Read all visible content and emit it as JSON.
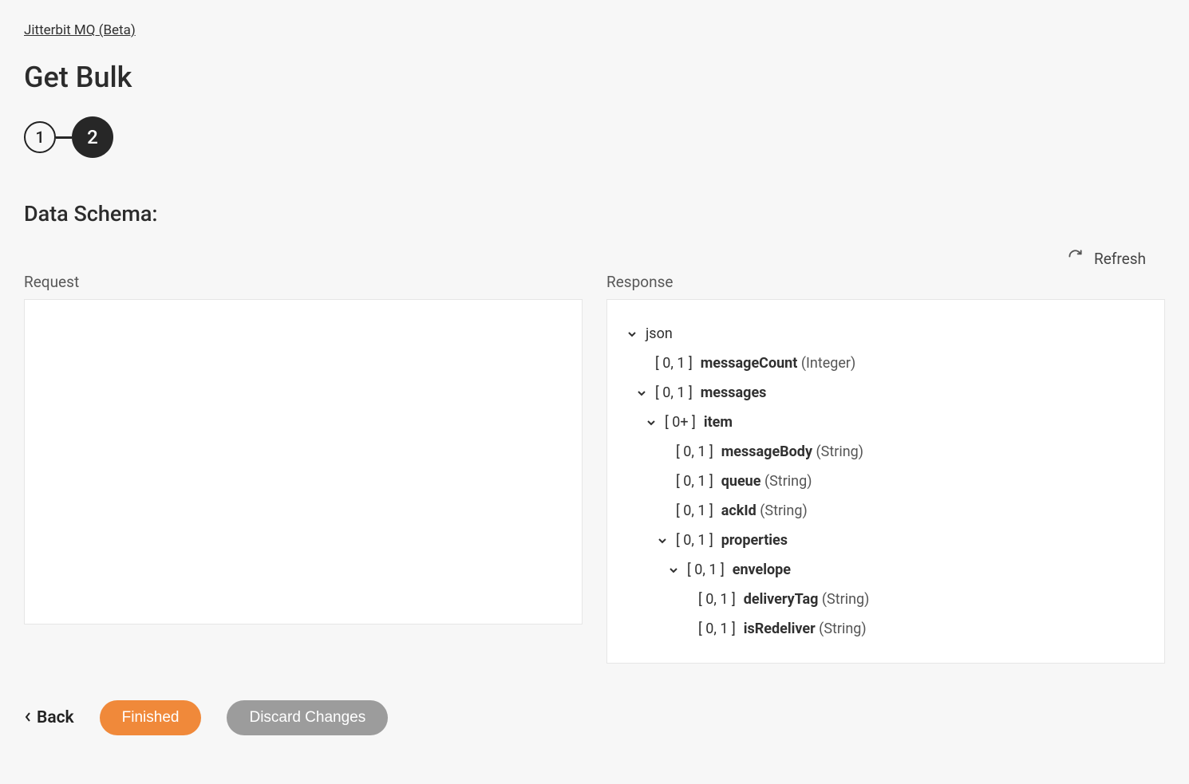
{
  "breadcrumb": "Jitterbit MQ (Beta)",
  "title": "Get Bulk",
  "stepper": {
    "step1": "1",
    "step2": "2"
  },
  "section_label": "Data Schema:",
  "refresh_label": "Refresh",
  "request_label": "Request",
  "response_label": "Response",
  "tree": {
    "root": "json",
    "n0": {
      "card": "[ 0, 1 ]",
      "name": "messageCount",
      "type": "(Integer)"
    },
    "n1": {
      "card": "[ 0, 1 ]",
      "name": "messages"
    },
    "n2": {
      "card": "[ 0+ ]",
      "name": "item"
    },
    "n3": {
      "card": "[ 0, 1 ]",
      "name": "messageBody",
      "type": "(String)"
    },
    "n4": {
      "card": "[ 0, 1 ]",
      "name": "queue",
      "type": "(String)"
    },
    "n5": {
      "card": "[ 0, 1 ]",
      "name": "ackId",
      "type": "(String)"
    },
    "n6": {
      "card": "[ 0, 1 ]",
      "name": "properties"
    },
    "n7": {
      "card": "[ 0, 1 ]",
      "name": "envelope"
    },
    "n8": {
      "card": "[ 0, 1 ]",
      "name": "deliveryTag",
      "type": "(String)"
    },
    "n9": {
      "card": "[ 0, 1 ]",
      "name": "isRedeliver",
      "type": "(String)"
    }
  },
  "footer": {
    "back": "Back",
    "finished": "Finished",
    "discard": "Discard Changes"
  }
}
